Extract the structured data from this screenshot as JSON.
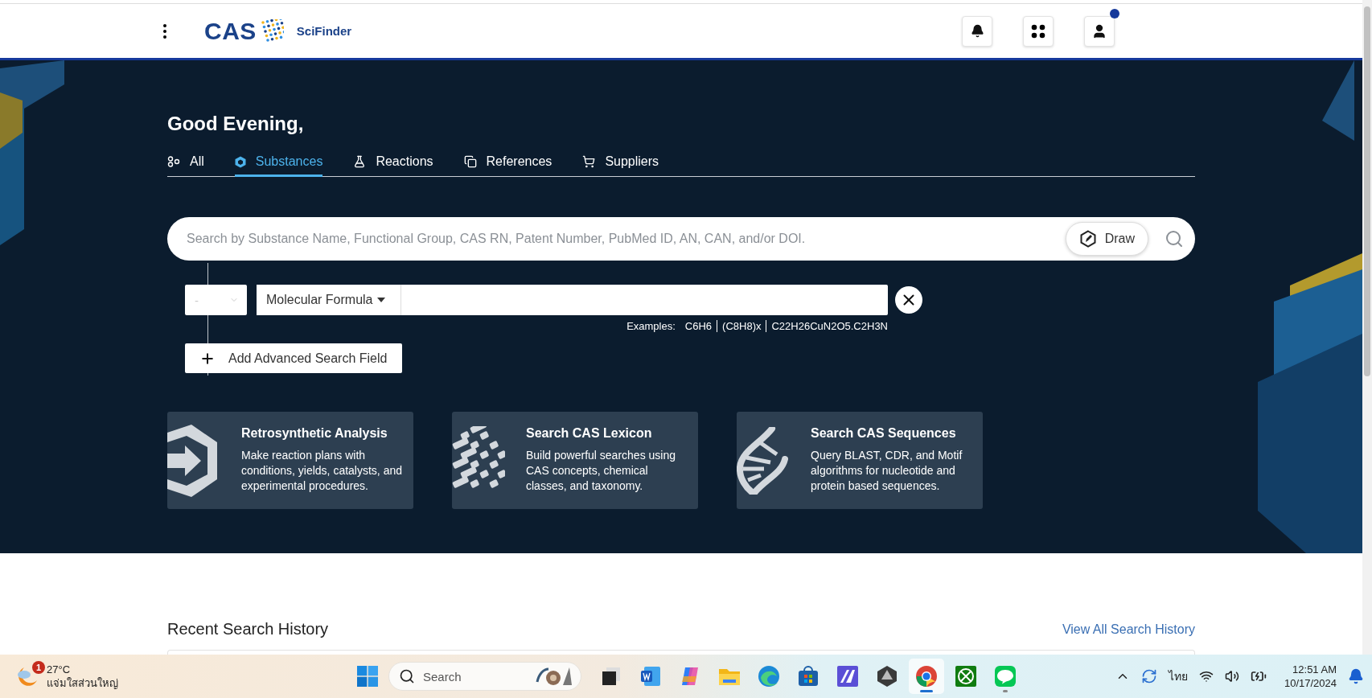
{
  "header": {
    "logo": {
      "mark": "CAS",
      "product": "SciFinder"
    },
    "account_notification": true
  },
  "hero": {
    "greeting": "Good Evening,",
    "tabs": [
      {
        "label": "All",
        "kind": "all",
        "selected": false
      },
      {
        "label": "Substances",
        "kind": "substances",
        "selected": true
      },
      {
        "label": "Reactions",
        "kind": "reactions",
        "selected": false
      },
      {
        "label": "References",
        "kind": "references",
        "selected": false
      },
      {
        "label": "Suppliers",
        "kind": "suppliers",
        "selected": false
      }
    ],
    "search": {
      "placeholder": "Search by Substance Name, Functional Group, CAS RN, Patent Number, PubMed ID, AN, CAN, and/or DOI.",
      "draw_button": "Draw"
    },
    "advanced": {
      "operator": "-",
      "field": "Molecular Formula",
      "examples_label": "Examples:",
      "examples": [
        "C6H6",
        "(C8H8)x",
        "C22H26CuN2O5.C2H3N"
      ],
      "add_button": "Add Advanced Search Field"
    },
    "cards": [
      {
        "kind": "retro",
        "title": "Retrosynthetic Analysis",
        "description": "Make reaction plans with conditions, yields, catalysts, and experimental procedures."
      },
      {
        "kind": "lexicon",
        "title": "Search CAS Lexicon",
        "description": "Build powerful searches using CAS concepts, chemical classes, and taxonomy."
      },
      {
        "kind": "sequences",
        "title": "Search CAS Sequences",
        "description": "Query BLAST, CDR, and Motif algorithms for nucleotide and protein based sequences."
      }
    ]
  },
  "recent": {
    "title": "Recent Search History",
    "link": "View All Search History"
  },
  "taskbar": {
    "weather": {
      "badge": "1",
      "temperature": "27°C",
      "condition": "แจ่มใสส่วนใหญ่"
    },
    "search_placeholder": "Search",
    "apps": [
      {
        "kind": "taskview",
        "selected": false,
        "running": false
      },
      {
        "kind": "word",
        "selected": false,
        "running": false
      },
      {
        "kind": "copilot",
        "selected": false,
        "running": false
      },
      {
        "kind": "folder",
        "selected": false,
        "running": false
      },
      {
        "kind": "edge",
        "selected": false,
        "running": false
      },
      {
        "kind": "store",
        "selected": false,
        "running": false
      },
      {
        "kind": "editor",
        "selected": false,
        "running": false
      },
      {
        "kind": "gem",
        "selected": false,
        "running": false
      },
      {
        "kind": "chrome",
        "selected": true,
        "running": true
      },
      {
        "kind": "xbox",
        "selected": false,
        "running": false
      },
      {
        "kind": "line",
        "selected": false,
        "running": true
      }
    ],
    "language": "ไทย",
    "time": "12:51 AM",
    "date": "10/17/2024"
  }
}
